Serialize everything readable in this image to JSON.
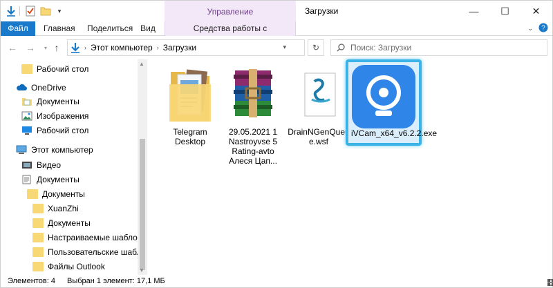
{
  "window": {
    "title": "Загрузки",
    "manage_tab": "Управление",
    "controls": {
      "minimize": "—",
      "maximize": "☐",
      "close": "✕"
    }
  },
  "ribbon": {
    "tabs": [
      "Файл",
      "Главная",
      "Поделиться",
      "Вид",
      "Средства работы с приложениями"
    ]
  },
  "address": {
    "crumbs": [
      "Этот компьютер",
      "Загрузки"
    ],
    "search_placeholder": "Поиск: Загрузки"
  },
  "nav": {
    "items": [
      {
        "label": "Рабочий стол",
        "icon": "folder-icon"
      },
      {
        "label": "OneDrive",
        "icon": "cloud-icon"
      },
      {
        "label": "Документы",
        "icon": "documents-icon"
      },
      {
        "label": "Изображения",
        "icon": "pictures-icon"
      },
      {
        "label": "Рабочий стол",
        "icon": "desktop-icon"
      },
      {
        "label": "Этот компьютер",
        "icon": "computer-icon"
      },
      {
        "label": "Видео",
        "icon": "video-icon"
      },
      {
        "label": "Документы",
        "icon": "documents-icon"
      },
      {
        "label": "Документы",
        "icon": "folder-icon"
      },
      {
        "label": "XuanZhi",
        "icon": "folder-icon"
      },
      {
        "label": "Документы",
        "icon": "folder-icon"
      },
      {
        "label": "Настраиваемые шаблоны С",
        "icon": "folder-icon"
      },
      {
        "label": "Пользовательские шаблоны",
        "icon": "folder-icon"
      },
      {
        "label": "Файлы Outlook",
        "icon": "folder-icon"
      }
    ]
  },
  "files": [
    {
      "label": "Telegram Desktop",
      "icon": "folder-icon"
    },
    {
      "label": "29.05.2021 1 Nastroyvse 5 Rating-avto Алеся Цап...",
      "icon": "winrar-archive-icon"
    },
    {
      "label": "DrainNGenQueue.wsf",
      "icon": "script-file-icon"
    },
    {
      "label": "iVCam_x64_v6.2.2.exe",
      "icon": "ivcam-icon",
      "selected": true
    }
  ],
  "status": {
    "count": "Элементов: 4",
    "selection": "Выбран 1 элемент: 17,1 МБ"
  },
  "colors": {
    "accent": "#1979ca",
    "manage_bg": "#f2e8f7",
    "selection_border": "#3bb3e6",
    "ivcam_blue": "#2f86e8",
    "folder": "#f8d775"
  }
}
